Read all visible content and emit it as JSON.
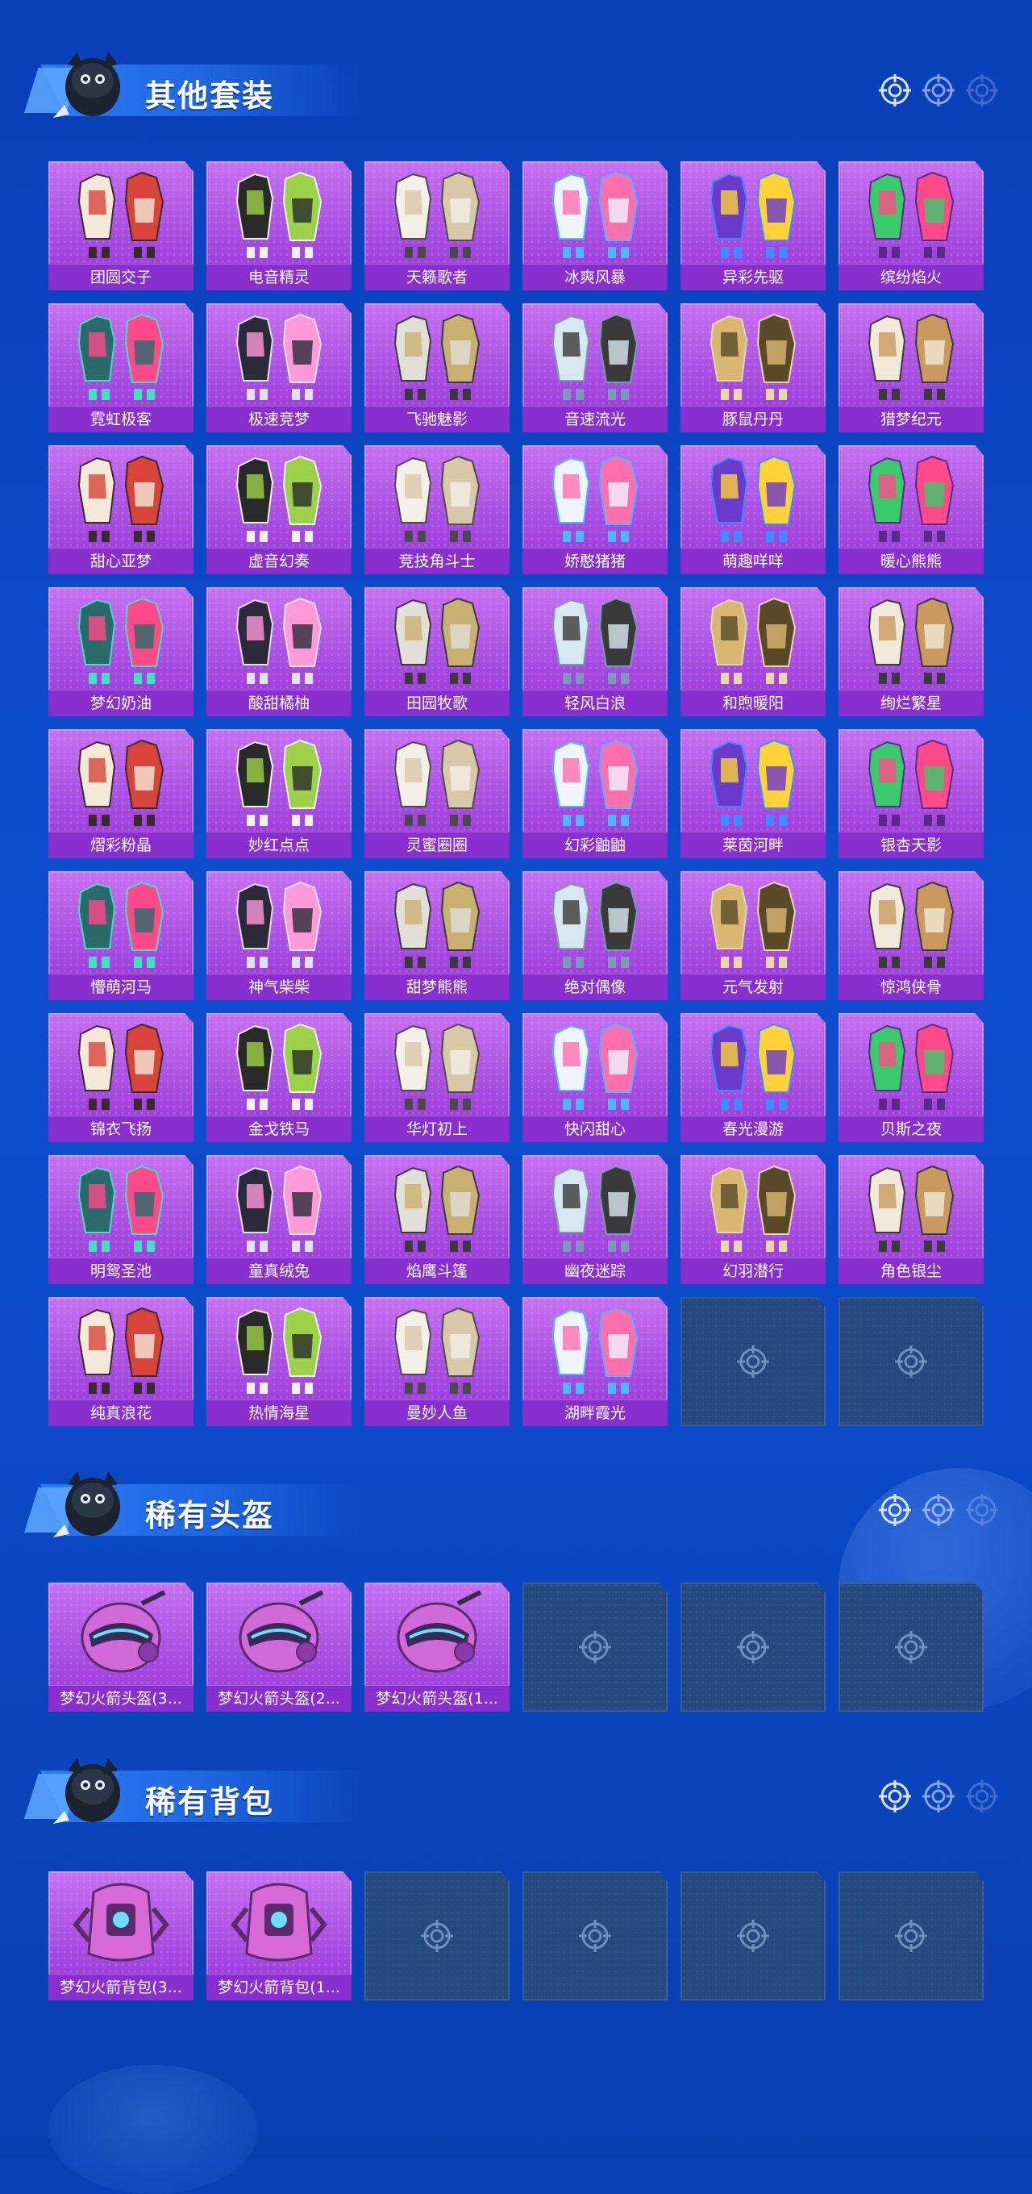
{
  "colors": {
    "background": "#0d4fcf",
    "card_fill": "#a64be0",
    "card_label_bg": "#8a2fcf",
    "empty_slot": "#25487f",
    "title_text": "#ffffff"
  },
  "sections": [
    {
      "title": "其他套装",
      "icon": "mascot-icon",
      "items": [
        {
          "label": "团圆交子",
          "icon": "outfit-icon"
        },
        {
          "label": "电音精灵",
          "icon": "outfit-icon"
        },
        {
          "label": "天籁歌者",
          "icon": "outfit-icon"
        },
        {
          "label": "冰爽风暴",
          "icon": "outfit-icon"
        },
        {
          "label": "异彩先驱",
          "icon": "outfit-icon"
        },
        {
          "label": "缤纷焰火",
          "icon": "outfit-icon"
        },
        {
          "label": "霓虹极客",
          "icon": "outfit-icon"
        },
        {
          "label": "极速竞梦",
          "icon": "outfit-icon"
        },
        {
          "label": "飞驰魅影",
          "icon": "outfit-icon"
        },
        {
          "label": "音速流光",
          "icon": "outfit-icon"
        },
        {
          "label": "豚鼠丹丹",
          "icon": "outfit-icon"
        },
        {
          "label": "猎梦纪元",
          "icon": "outfit-icon"
        },
        {
          "label": "甜心亚梦",
          "icon": "outfit-icon"
        },
        {
          "label": "虚音幻奏",
          "icon": "outfit-icon"
        },
        {
          "label": "竞技角斗士",
          "icon": "outfit-icon"
        },
        {
          "label": "娇憨猪猪",
          "icon": "outfit-icon"
        },
        {
          "label": "萌趣咩咩",
          "icon": "outfit-icon"
        },
        {
          "label": "暖心熊熊",
          "icon": "outfit-icon"
        },
        {
          "label": "梦幻奶油",
          "icon": "outfit-icon"
        },
        {
          "label": "酸甜橘柚",
          "icon": "outfit-icon"
        },
        {
          "label": "田园牧歌",
          "icon": "outfit-icon"
        },
        {
          "label": "轻风白浪",
          "icon": "outfit-icon"
        },
        {
          "label": "和煦暖阳",
          "icon": "outfit-icon"
        },
        {
          "label": "绚烂繁星",
          "icon": "outfit-icon"
        },
        {
          "label": "熠彩粉晶",
          "icon": "outfit-icon"
        },
        {
          "label": "妙红点点",
          "icon": "outfit-icon"
        },
        {
          "label": "灵蜜圈圈",
          "icon": "outfit-icon"
        },
        {
          "label": "幻彩鼬鼬",
          "icon": "outfit-icon"
        },
        {
          "label": "莱茵河畔",
          "icon": "outfit-icon"
        },
        {
          "label": "银杏天影",
          "icon": "outfit-icon"
        },
        {
          "label": "懵萌河马",
          "icon": "outfit-icon"
        },
        {
          "label": "神气柴柴",
          "icon": "outfit-icon"
        },
        {
          "label": "甜梦熊熊",
          "icon": "outfit-icon"
        },
        {
          "label": "绝对偶像",
          "icon": "outfit-icon"
        },
        {
          "label": "元气发射",
          "icon": "outfit-icon"
        },
        {
          "label": "惊鸿侠骨",
          "icon": "outfit-icon"
        },
        {
          "label": "锦衣飞扬",
          "icon": "outfit-icon"
        },
        {
          "label": "金戈铁马",
          "icon": "outfit-icon"
        },
        {
          "label": "华灯初上",
          "icon": "outfit-icon"
        },
        {
          "label": "快闪甜心",
          "icon": "outfit-icon"
        },
        {
          "label": "春光漫游",
          "icon": "outfit-icon"
        },
        {
          "label": "贝斯之夜",
          "icon": "outfit-icon"
        },
        {
          "label": "明鸳圣池",
          "icon": "outfit-icon"
        },
        {
          "label": "童真绒兔",
          "icon": "outfit-icon"
        },
        {
          "label": "焰鹰斗篷",
          "icon": "outfit-icon"
        },
        {
          "label": "幽夜迷踪",
          "icon": "outfit-icon"
        },
        {
          "label": "幻羽潜行",
          "icon": "outfit-icon"
        },
        {
          "label": "角色银尘",
          "icon": "outfit-icon"
        },
        {
          "label": "纯真浪花",
          "icon": "outfit-icon"
        },
        {
          "label": "热情海星",
          "icon": "outfit-icon"
        },
        {
          "label": "曼妙人鱼",
          "icon": "outfit-icon"
        },
        {
          "label": "湖畔霞光",
          "icon": "outfit-icon"
        },
        {
          "label": "",
          "icon": "crosshair-icon",
          "empty": true
        },
        {
          "label": "",
          "icon": "crosshair-icon",
          "empty": true
        }
      ]
    },
    {
      "title": "稀有头盔",
      "icon": "mascot-icon",
      "items": [
        {
          "label": "梦幻火箭头盔(3...",
          "icon": "helmet-icon"
        },
        {
          "label": "梦幻火箭头盔(2...",
          "icon": "helmet-icon"
        },
        {
          "label": "梦幻火箭头盔(1...",
          "icon": "helmet-icon"
        },
        {
          "label": "",
          "icon": "crosshair-icon",
          "empty": true
        },
        {
          "label": "",
          "icon": "crosshair-icon",
          "empty": true
        },
        {
          "label": "",
          "icon": "crosshair-icon",
          "empty": true
        }
      ]
    },
    {
      "title": "稀有背包",
      "icon": "mascot-icon",
      "items": [
        {
          "label": "梦幻火箭背包(3...",
          "icon": "backpack-icon"
        },
        {
          "label": "梦幻火箭背包(1...",
          "icon": "backpack-icon"
        },
        {
          "label": "",
          "icon": "crosshair-icon",
          "empty": true
        },
        {
          "label": "",
          "icon": "crosshair-icon",
          "empty": true
        },
        {
          "label": "",
          "icon": "crosshair-icon",
          "empty": true
        },
        {
          "label": "",
          "icon": "crosshair-icon",
          "empty": true
        }
      ]
    }
  ]
}
